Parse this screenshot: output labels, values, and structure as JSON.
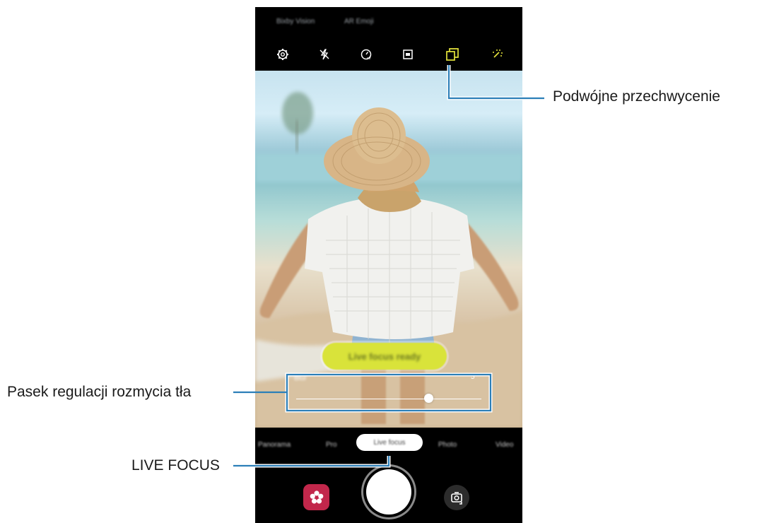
{
  "callouts": {
    "dual_capture": "Podwójne przechwycenie",
    "blur_bar": "Pasek regulacji rozmycia tła",
    "live_focus": "LIVE FOCUS"
  },
  "camera": {
    "top_links": [
      "Bixby Vision",
      "AR Emoji"
    ],
    "top_icons": [
      "settings-icon",
      "flash-off-icon",
      "timer-icon",
      "aspect-ratio-icon",
      "dual-capture-icon",
      "filter-effects-icon"
    ],
    "ready_text": "Live focus ready",
    "blur": {
      "min_label": "Blur",
      "max_label": "5",
      "level_fraction": 0.7
    },
    "modes": [
      "Panorama",
      "Pro",
      "Live focus",
      "Photo",
      "Video"
    ],
    "active_mode": "Live focus",
    "bottom_icons": [
      "gallery-flower-icon",
      "shutter-button",
      "switch-camera-icon"
    ]
  },
  "colors": {
    "accent_yellow": "#d6e23a",
    "callout_line": "#2c7fb8",
    "gallery_red": "#c2274b"
  }
}
